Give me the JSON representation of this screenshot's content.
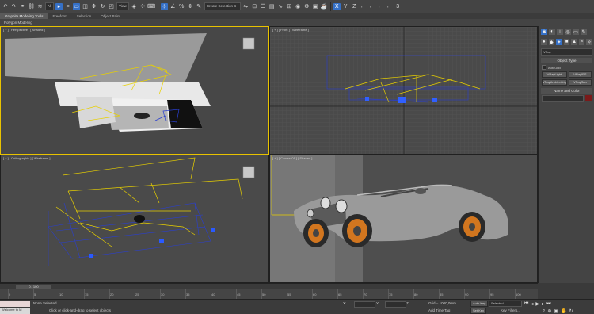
{
  "toolbar": {
    "filter_value": "All",
    "view_value": "View",
    "selection_set_placeholder": "Create Selection S",
    "number_label": "3"
  },
  "ribbon": {
    "tabs": [
      "Graphite Modeling Tools",
      "Freeform",
      "Selection",
      "Object Paint"
    ],
    "active_tab": 0,
    "sub_label": "Polygon Modeling"
  },
  "viewports": {
    "perspective": "[ + ] [ Perspective ] [ Shaded ]",
    "front": "[ + ] [ Front ] [ Wireframe ]",
    "orthographic": "[ + ] [ Orthographic ] [ Wireframe ]",
    "camera": "[ + ] [ Camera01 ] [ Shaded ]"
  },
  "command_panel": {
    "category_value": "VRay",
    "object_type_title": "Object Type",
    "autogrid_label": "AutoGrid",
    "buttons": [
      "VRayLight",
      "VRayIES",
      "VRayAmbientLig",
      "VRaySun"
    ],
    "name_color_title": "Name and Color"
  },
  "timeline": {
    "slider": "0 / 100",
    "ticks": [
      "0",
      "5",
      "10",
      "15",
      "20",
      "25",
      "30",
      "35",
      "40",
      "45",
      "50",
      "55",
      "60",
      "65",
      "70",
      "75",
      "80",
      "85",
      "90",
      "95",
      "100"
    ]
  },
  "status": {
    "selection_info": "None Selected",
    "prompt": "Click or click-and-drag to select objects",
    "maxscript": "Welcome to M",
    "grid": "Grid = 1000,0mm",
    "add_time_tag": "Add Time Tag",
    "auto_key": "Auto Key",
    "set_key": "Set Key",
    "selected_value": "Selected",
    "key_filters": "Key Filters...",
    "x_label": "X:",
    "y_label": "Y:",
    "z_label": "Z:"
  },
  "colors": {
    "active_border": "#e8c200",
    "accent_blue": "#3570c6",
    "wire_yellow": "#e8d000",
    "wire_blue": "#2a3fd0",
    "viewport_bg": "#4a4a4a"
  }
}
